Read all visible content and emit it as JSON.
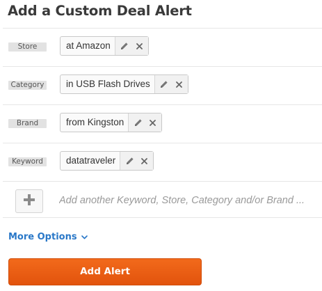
{
  "page": {
    "title": "Add a Custom Deal Alert"
  },
  "criteria": [
    {
      "label": "Store",
      "value": "at Amazon"
    },
    {
      "label": "Category",
      "value": "in USB Flash Drives"
    },
    {
      "label": "Brand",
      "value": "from Kingston"
    },
    {
      "label": "Keyword",
      "value": "datatraveler"
    }
  ],
  "icons": {
    "edit": "pencil-icon",
    "remove": "close-icon",
    "add": "plus-icon",
    "more": "chevron-down-icon"
  },
  "add_criteria": {
    "placeholder": "Add another Keyword, Store, Category and/or Brand ..."
  },
  "more_options": {
    "label": "More Options"
  },
  "submit": {
    "label": "Add Alert"
  },
  "colors": {
    "accent_orange": "#f26a1b",
    "link_blue": "#2a78c8",
    "label_bg": "#e2e2e2"
  }
}
